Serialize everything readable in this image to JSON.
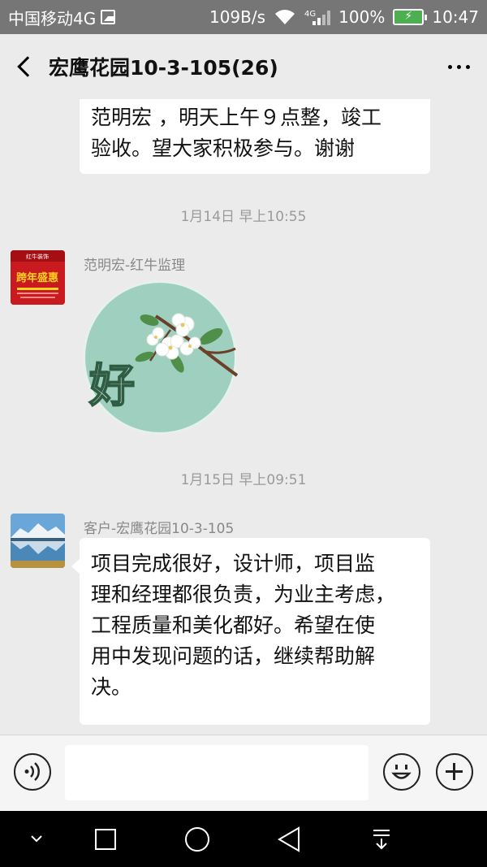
{
  "status_bar": {
    "carrier": "中国移动4G",
    "network_speed": "109B/s",
    "lte_label": "4G",
    "battery": "100%",
    "time": "10:47"
  },
  "nav": {
    "title": "宏鹰花园10-3-105(26)"
  },
  "messages": [
    {
      "type": "text",
      "text_lines": [
        "范明宏 ，明天上午９点整，竣工",
        "验收。望大家积极参与。谢谢"
      ]
    },
    {
      "type": "time",
      "text": "1月14日 早上10:55"
    },
    {
      "type": "sticker",
      "sender": "范明宏-红牛监理",
      "sticker_text": "好",
      "avatar_text": [
        "红牛装饰",
        "跨年盛惠"
      ]
    },
    {
      "type": "time",
      "text": "1月15日 早上09:51"
    },
    {
      "type": "text",
      "sender": "客户-宏鹰花园10-3-105",
      "text_lines": [
        "项目完成很好，设计师，项目监",
        "理和经理都很负责，为业主考虑，",
        "工程质量和美化都好。希望在使",
        "用中发现问题的话，继续帮助解",
        "决。"
      ]
    }
  ],
  "colors": {
    "status_bar_bg": "#767676",
    "chat_bg": "#ebebeb",
    "bubble_bg": "#ffffff",
    "battery_green": "#4caf50"
  },
  "icons": {
    "back": "chevron-left-icon",
    "more": "more-dots-icon",
    "voice": "voice-icon",
    "emoji": "smiley-icon",
    "plus": "plus-icon",
    "sys_down": "chevron-down-icon",
    "sys_recent": "square-icon",
    "sys_home": "circle-icon",
    "sys_back": "triangle-back-icon",
    "sys_pulldown": "pull-down-icon"
  }
}
